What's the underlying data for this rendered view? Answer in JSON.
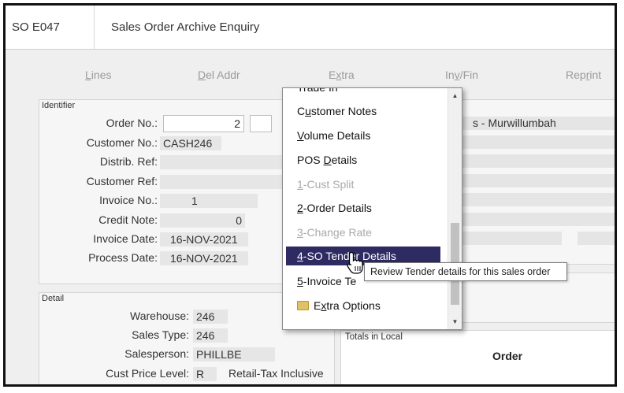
{
  "header": {
    "code": "SO E047",
    "title": "Sales Order Archive Enquiry"
  },
  "tabs": [
    {
      "pre": "",
      "key": "L",
      "post": "ines"
    },
    {
      "pre": "",
      "key": "D",
      "post": "el Addr"
    },
    {
      "pre": "E",
      "key": "x",
      "post": "tra"
    },
    {
      "pre": "In",
      "key": "v",
      "post": "/Fin"
    },
    {
      "pre": "Rep",
      "key": "r",
      "post": "int"
    }
  ],
  "identifier": {
    "label": "Identifier",
    "order_no_label": "Order No.:",
    "order_no": "2",
    "customer_no_label": "Customer No.:",
    "customer_no": "CASH246",
    "distrib_ref_label": "Distrib. Ref:",
    "customer_ref_label": "Customer Ref:",
    "invoice_no_label": "Invoice No.:",
    "invoice_no": "1",
    "credit_note_label": "Credit Note:",
    "credit_note": "0",
    "invoice_date_label": "Invoice Date:",
    "invoice_date": "16-NOV-2021",
    "process_date_label": "Process Date:",
    "process_date": "16-NOV-2021"
  },
  "right_partial": {
    "customer_name_fragment": "s - Murwillumbah"
  },
  "detail": {
    "label": "Detail",
    "warehouse_label": "Warehouse:",
    "warehouse": "246",
    "sales_type_label": "Sales Type:",
    "sales_type": "246",
    "salesperson_label": "Salesperson:",
    "salesperson": "PHILLBE",
    "cust_price_level_label": "Cust Price Level:",
    "cust_price_level": "R",
    "cust_price_level_desc": "Retail-Tax Inclusive"
  },
  "totals": {
    "label": "Totals in Local",
    "order_header": "Order"
  },
  "extra_menu": {
    "partial_top": "Trade In",
    "items": [
      {
        "pre": "C",
        "key": "u",
        "post": "stomer Notes",
        "disabled": false
      },
      {
        "pre": "",
        "key": "V",
        "post": "olume Details",
        "disabled": false
      },
      {
        "pre": "POS ",
        "key": "D",
        "post": "etails",
        "disabled": false
      },
      {
        "pre": "",
        "key": "1",
        "post": "-Cust Split",
        "disabled": true
      },
      {
        "pre": "",
        "key": "2",
        "post": "-Order Details",
        "disabled": false
      },
      {
        "pre": "",
        "key": "3",
        "post": "-Change Rate",
        "disabled": true
      },
      {
        "pre": "",
        "key": "4",
        "post": "-SO Tender Details",
        "disabled": false,
        "selected": true
      },
      {
        "pre": "",
        "key": "5",
        "post": "-Invoice Te",
        "disabled": false
      },
      {
        "pre": "E",
        "key": "x",
        "post": "tra Options",
        "disabled": false,
        "icon": "folder-icon"
      }
    ]
  },
  "tooltip": "Review Tender details for this sales order",
  "colors": {
    "menu_selected_bg": "#2e2a62",
    "field_bg": "#e6e6e6"
  }
}
